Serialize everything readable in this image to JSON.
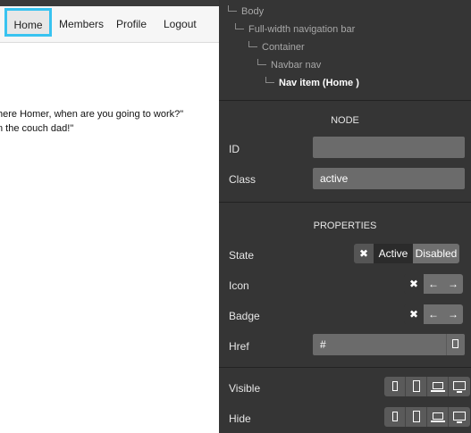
{
  "preview": {
    "nav_items": [
      "Home",
      "Members",
      "Profile",
      "Logout"
    ],
    "quote_line1": "here Homer, when are you going to work?\"",
    "quote_line2": "n the couch dad!\""
  },
  "tree": {
    "body": "Body",
    "fullwidth": "Full-width navigation bar",
    "container": "Container",
    "navbarnav": "Navbar nav",
    "navitem": "Nav item (Home )"
  },
  "node": {
    "title": "NODE",
    "id_label": "ID",
    "id_value": "",
    "class_label": "Class",
    "class_value": "active"
  },
  "properties": {
    "title": "PROPERTIES",
    "state_label": "State",
    "state_active": "Active",
    "state_disabled": "Disabled",
    "icon_label": "Icon",
    "badge_label": "Badge",
    "href_label": "Href",
    "href_value": "#",
    "visible_label": "Visible",
    "hide_label": "Hide"
  },
  "icons": {
    "close": "✖",
    "left": "←",
    "right": "→"
  },
  "colors": {
    "accent": "#38c3f0",
    "panel_bg": "#353535",
    "field_bg": "#6b6b6b"
  }
}
